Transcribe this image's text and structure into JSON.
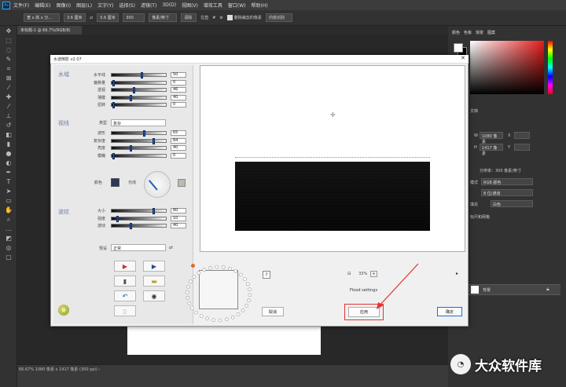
{
  "app": {
    "menu": [
      "文件(F)",
      "编辑(E)",
      "图像(I)",
      "图层(L)",
      "文字(Y)",
      "选择(S)",
      "滤镜(T)",
      "3D(D)",
      "视图(V)",
      "增效工具",
      "窗口(W)",
      "帮助(H)"
    ],
    "ps_badge": "Ps"
  },
  "optionsbar": {
    "ratio": "宽 x 高 x 分...",
    "w_val": "3.6 厘米",
    "swap": "⇄",
    "h_val": "5.6 厘米",
    "res_val": "300",
    "unit": "像素/英寸",
    "clear": "清除",
    "straighten": "拉直",
    "grid": "#",
    "gear": "⚙",
    "delete_cropped": "删除裁剪的像素",
    "content_aware": "内容识别"
  },
  "document": {
    "tab_label": "未标题-1 @ 66.7%(RGB/8)",
    "status": "66.67%   1080 像素 x 1417 像素 (300 ppi)   ›"
  },
  "rightpanel": {
    "tabs": [
      "颜色",
      "色板",
      "渐变",
      "图案"
    ],
    "props_title": "文档",
    "w_label": "W",
    "w_val": "1080 像素",
    "x_label": "X",
    "h_label": "H",
    "h_val": "1417 像素",
    "y_label": "Y",
    "resolution": "分辨率：300 像素/英寸",
    "mode_label": "模式",
    "mode_val": "RGB 颜色",
    "bits_val": "8 位/通道",
    "fill_label": "填充",
    "fill_val": "白色",
    "canvas_title": "画布",
    "guides_title": "标尺和网格",
    "layer_name": "背景"
  },
  "dialog": {
    "title": "水波倒影 v2.07",
    "close": "✕",
    "sections": {
      "water": "水域",
      "view": "视线",
      "ripple": "波纹"
    },
    "water_rows": [
      {
        "label": "水平线",
        "value": "50",
        "knob": 0.55
      },
      {
        "label": "偏移量",
        "value": "0",
        "knob": 0.02
      },
      {
        "label": "透视",
        "value": "46",
        "knob": 0.4
      },
      {
        "label": "薄膜",
        "value": "40",
        "knob": 0.35
      },
      {
        "label": "扭转",
        "value": "0",
        "knob": 0.02
      }
    ],
    "view_type_label": "类型",
    "view_type_value": "复杂",
    "view_rows": [
      {
        "label": "波形",
        "value": "65",
        "knob": 0.6
      },
      {
        "label": "复杂度",
        "value": "84",
        "knob": 0.78
      },
      {
        "label": "亮度",
        "value": "40",
        "knob": 0.35
      },
      {
        "label": "模糊",
        "value": "0",
        "knob": 0.02
      }
    ],
    "color_label": "颜色",
    "light_label": "光线",
    "ripple_rows": [
      {
        "label": "大小",
        "value": "80",
        "knob": 0.78
      },
      {
        "label": "强度",
        "value": "10",
        "knob": 0.09
      },
      {
        "label": "波动",
        "value": "40",
        "knob": 0.35
      }
    ],
    "preset_label": "预设",
    "preset_value": "正常",
    "preset_arrow": "⇄",
    "icon_buttons": [
      "▶",
      "▶",
      "▮",
      "▬",
      "↶",
      "◉",
      "▯"
    ],
    "question": "?",
    "cancel": "取消",
    "apply": "应用",
    "ok": "确定",
    "zoom_minus": "⊟",
    "zoom_value": "33%",
    "zoom_plus": "+",
    "flood_settings": "Flood settings",
    "nav_arrow": "▸",
    "logo": "✿"
  },
  "watermark": {
    "icon": "◔",
    "text": "大众软件库"
  }
}
